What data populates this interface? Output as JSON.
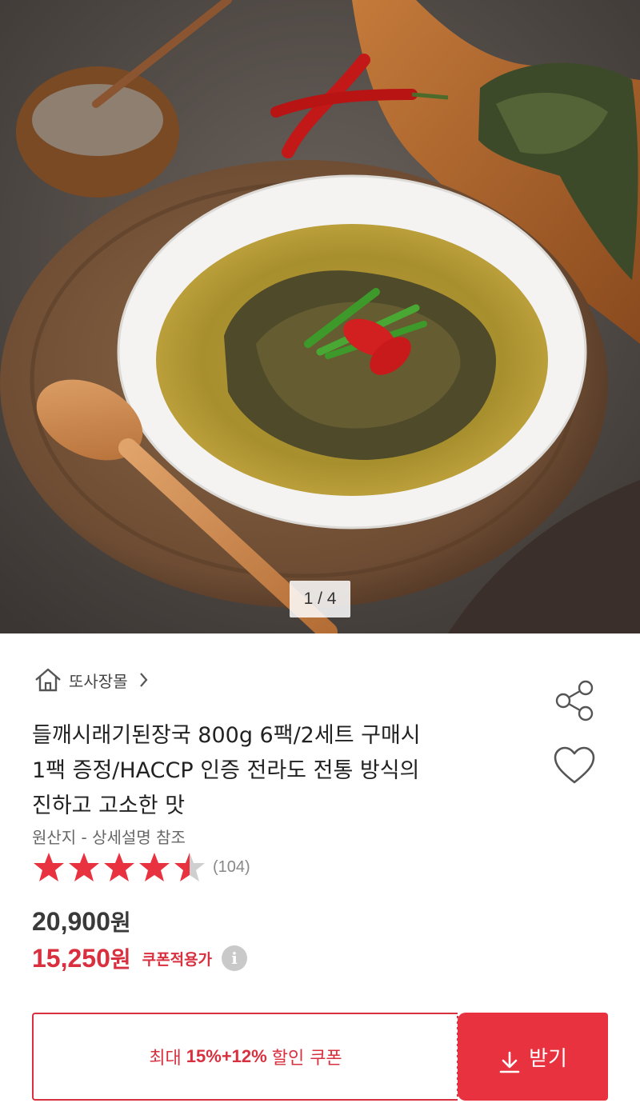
{
  "gallery": {
    "pager": "1 / 4",
    "image_alt": "soup-bowl-photo"
  },
  "store": {
    "name": "또사장몰",
    "home_icon": "home-icon",
    "chevron_icon": "chevron-right-icon"
  },
  "actions": {
    "share_icon": "share-icon",
    "wish_icon": "heart-icon"
  },
  "product": {
    "title_line1": "들깨시래기된장국 800g 6팩/2세트 구매시",
    "title_line2": "1팩 증정/HACCP 인증 전라도 전통 방식의",
    "title_line3": "진하고 고소한 맛",
    "origin": "원산지 - 상세설명 참조"
  },
  "rating": {
    "value": 4.5,
    "max": 5,
    "review_count": "(104)"
  },
  "price": {
    "original": "20,900",
    "original_unit": "원",
    "sale": "15,250",
    "sale_unit": "원",
    "coupon_label": "쿠폰적용가",
    "info_icon": "i"
  },
  "coupon": {
    "prefix": "최대",
    "percent": "15%+12%",
    "suffix": "할인 쿠폰",
    "button_label": "받기"
  },
  "colors": {
    "accent": "#e8323f",
    "sale": "#d9303f",
    "star": "#e8323f",
    "star_empty": "#cfcfcf"
  }
}
